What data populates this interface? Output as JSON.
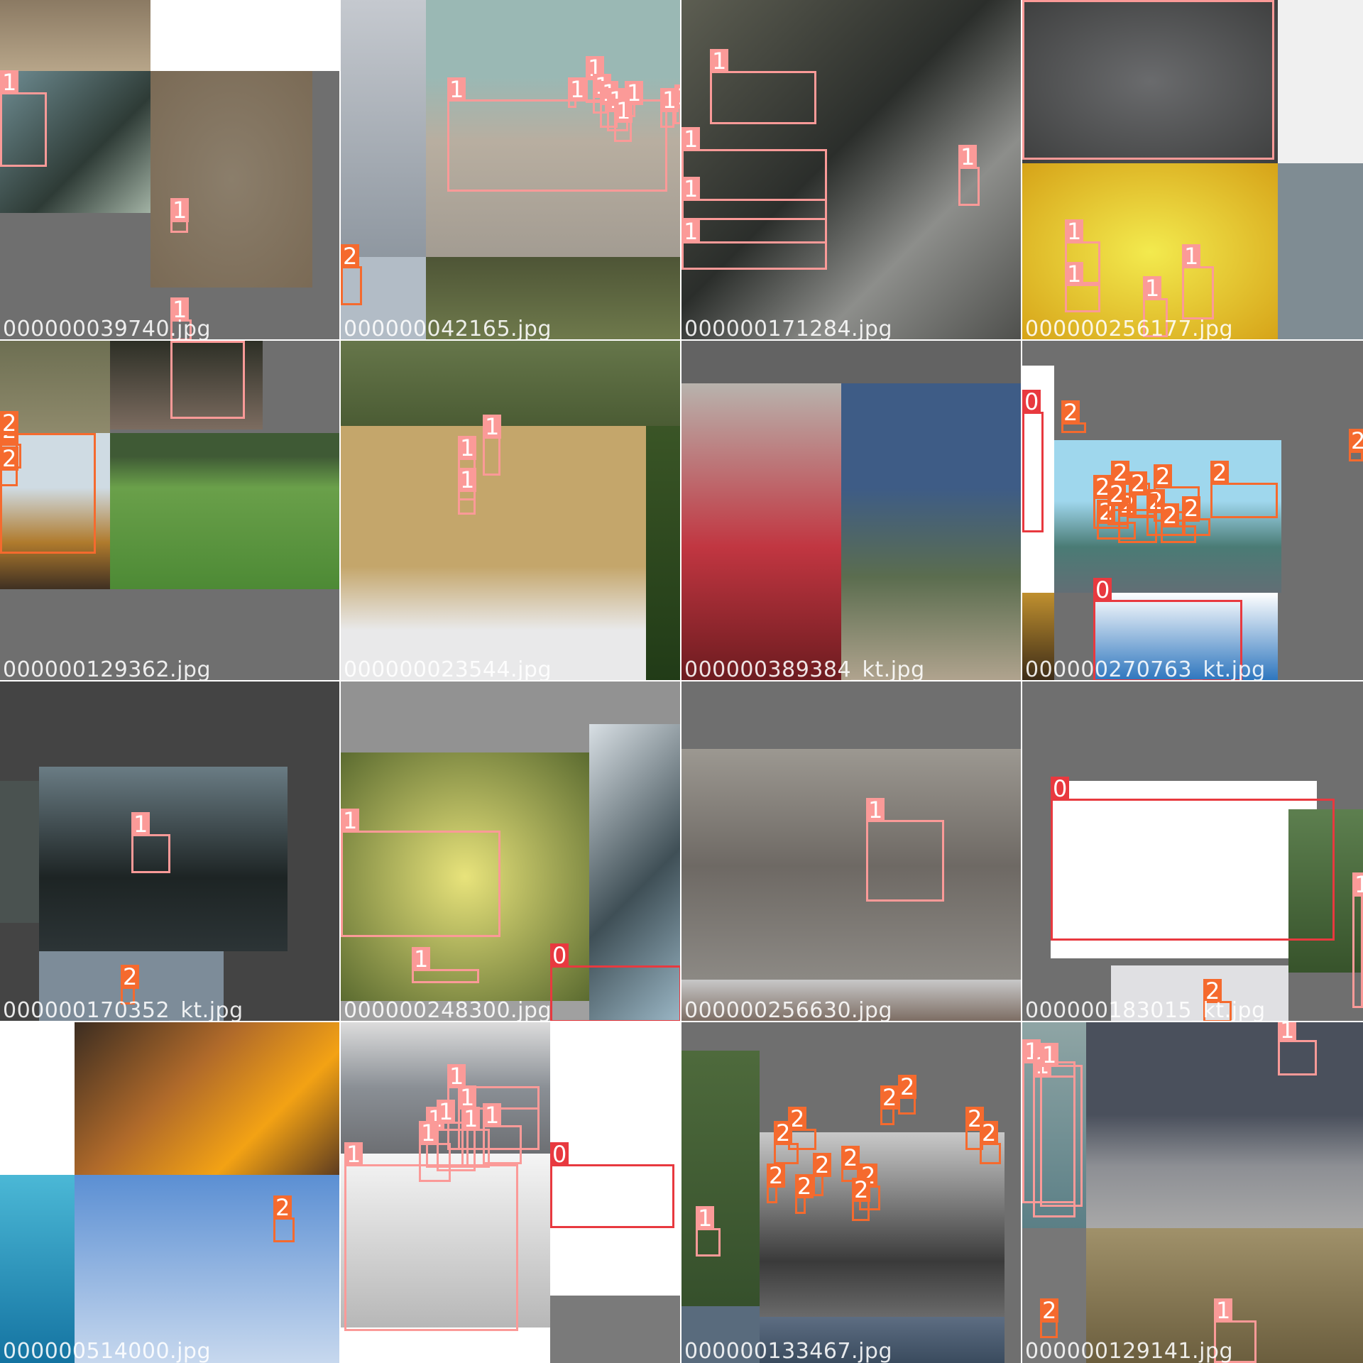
{
  "mosaic": {
    "class_colors": {
      "0": "#e8393f",
      "1": "#fb9a98",
      "2": "#f56a2e"
    },
    "tiles": [
      {
        "filename": "000000039740.jpg",
        "labels": [
          "1",
          "1",
          "1"
        ]
      },
      {
        "filename": "000000042165.jpg",
        "labels": [
          "1",
          "1",
          "1",
          "1",
          "1",
          "1",
          "1",
          "1",
          "1",
          "1",
          "1",
          "2"
        ]
      },
      {
        "filename": "000000171284.jpg",
        "labels": [
          "1",
          "1",
          "1",
          "1",
          "1"
        ]
      },
      {
        "filename": "000000256177.jpg",
        "labels": [
          "1",
          "1",
          "1",
          "1",
          "1"
        ]
      },
      {
        "filename": "000000129362.jpg",
        "labels": [
          "1",
          "2",
          "2",
          "2",
          "2",
          "1",
          "1",
          "1"
        ]
      },
      {
        "filename": "000000023544.jpg",
        "labels": [
          "1",
          "1",
          "1"
        ]
      },
      {
        "filename": "000000389384_kt.jpg",
        "labels": []
      },
      {
        "filename": "000000270763_kt.jpg",
        "labels": [
          "0",
          "0",
          "2",
          "2",
          "2",
          "2",
          "2",
          "2",
          "2",
          "2",
          "2",
          "2",
          "2",
          "2",
          "2"
        ]
      },
      {
        "filename": "000000170352_kt.jpg",
        "labels": [
          "1",
          "2"
        ]
      },
      {
        "filename": "000000248300.jpg",
        "labels": [
          "1",
          "1",
          "0"
        ]
      },
      {
        "filename": "000000256630.jpg",
        "labels": [
          "1"
        ]
      },
      {
        "filename": "000000183015_kt.jpg",
        "labels": [
          "0",
          "1",
          "2"
        ]
      },
      {
        "filename": "000000514000.jpg",
        "labels": [
          "2"
        ]
      },
      {
        "filename": "000000452674.jpg",
        "labels": [
          "1",
          "1",
          "1",
          "1",
          "1",
          "1",
          "1",
          "1",
          "0"
        ]
      },
      {
        "filename": "000000133467.jpg",
        "labels": [
          "1",
          "1",
          "2",
          "2",
          "2",
          "2",
          "2",
          "2",
          "2",
          "2",
          "2",
          "2",
          "2",
          "2"
        ]
      },
      {
        "filename": "000000129141.jpg",
        "labels": [
          "1",
          "1",
          "1",
          "1",
          "1",
          "2"
        ]
      }
    ]
  }
}
